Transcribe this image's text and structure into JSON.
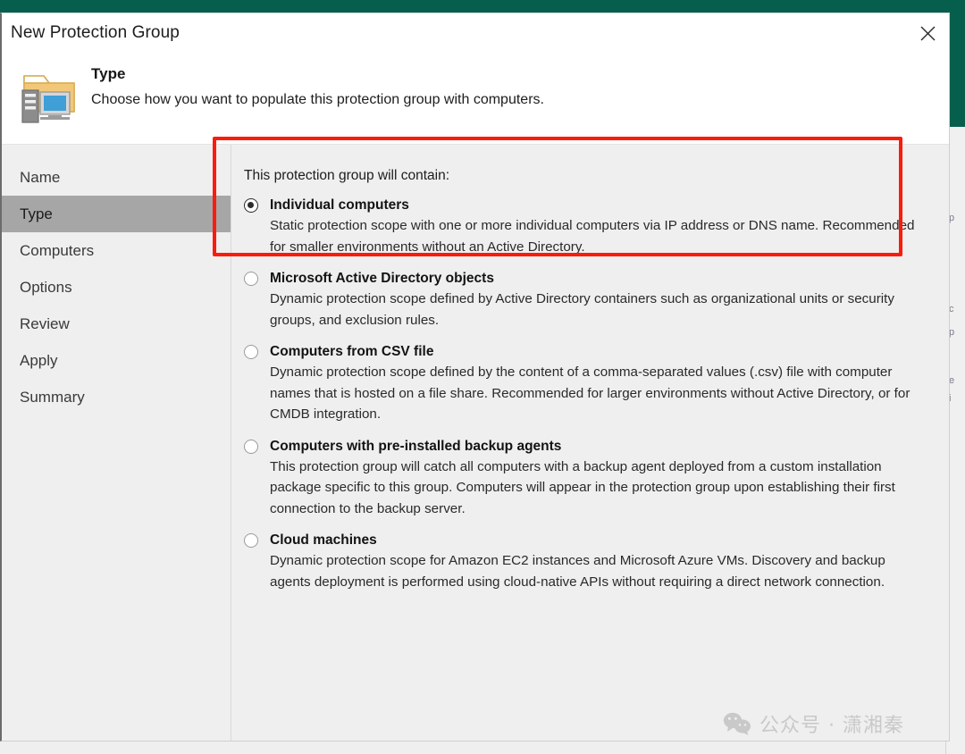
{
  "window": {
    "title": "New Protection Group",
    "close_label": "Close"
  },
  "header": {
    "icon": "folder-computer-icon",
    "title": "Type",
    "subtitle": "Choose how you want to populate this protection group with computers."
  },
  "sidebar": {
    "items": [
      {
        "label": "Name",
        "active": false
      },
      {
        "label": "Type",
        "active": true
      },
      {
        "label": "Computers",
        "active": false
      },
      {
        "label": "Options",
        "active": false
      },
      {
        "label": "Review",
        "active": false
      },
      {
        "label": "Apply",
        "active": false
      },
      {
        "label": "Summary",
        "active": false
      }
    ]
  },
  "main": {
    "intro": "This protection group will contain:",
    "options": [
      {
        "label": "Individual computers",
        "description": "Static protection scope with one or more individual computers via IP address or DNS name. Recommended for smaller environments without an Active Directory.",
        "selected": true
      },
      {
        "label": "Microsoft Active Directory objects",
        "description": "Dynamic protection scope defined by Active Directory containers such as organizational units or security groups, and exclusion rules.",
        "selected": false
      },
      {
        "label": "Computers from CSV file",
        "description": "Dynamic protection scope defined by the content of a comma-separated values (.csv) file with computer names that is hosted on a file share. Recommended for larger environments without Active Directory, or for CMDB integration.",
        "selected": false
      },
      {
        "label": "Computers with pre-installed backup agents",
        "description": "This protection group will catch all computers with a backup agent deployed from a custom installation package specific to this group.  Computers will appear in the protection group upon establishing their first connection to the backup server.",
        "selected": false
      },
      {
        "label": "Cloud machines",
        "description": "Dynamic protection scope for Amazon EC2 instances and Microsoft Azure VMs. Discovery and backup agents deployment is performed using cloud-native APIs without requiring a direct network connection.",
        "selected": false
      }
    ]
  },
  "annotation": {
    "highlight_color": "#fb1b0d",
    "target": "Individual computers"
  },
  "watermark": {
    "icon": "wechat-icon",
    "text": "公众号 · 潇湘秦"
  },
  "theme": {
    "accent_green": "#065f4c",
    "sidebar_bg": "#efefef",
    "active_item_bg": "#a6a6a6"
  }
}
